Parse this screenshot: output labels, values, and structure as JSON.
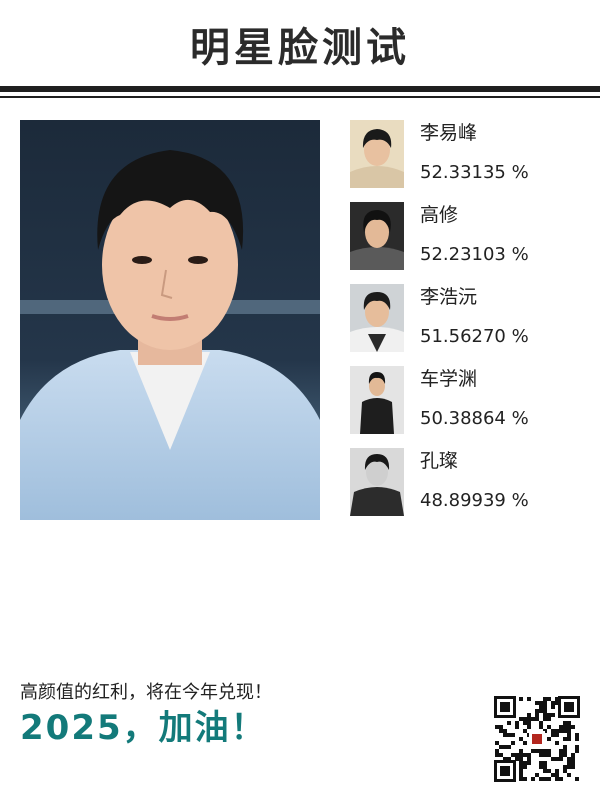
{
  "title": "明星脸测试",
  "main_photo": {
    "icon": "portrait-photo"
  },
  "results": [
    {
      "name": "李易峰",
      "score": "52.33135 %",
      "icon": "portrait-thumb"
    },
    {
      "name": "高修",
      "score": "52.23103 %",
      "icon": "portrait-thumb"
    },
    {
      "name": "李浩沅",
      "score": "51.56270 %",
      "icon": "portrait-thumb"
    },
    {
      "name": "车学渊",
      "score": "50.38864 %",
      "icon": "portrait-thumb"
    },
    {
      "name": "孔璨",
      "score": "48.89939 %",
      "icon": "portrait-thumb"
    }
  ],
  "footer": {
    "slogan": "高颜值的红利，将在今年兑现！",
    "cheer": "2025，加油！",
    "qr_icon": "qr-code"
  },
  "colors": {
    "accent": "#137a7a",
    "rule": "#1f1f1f"
  }
}
